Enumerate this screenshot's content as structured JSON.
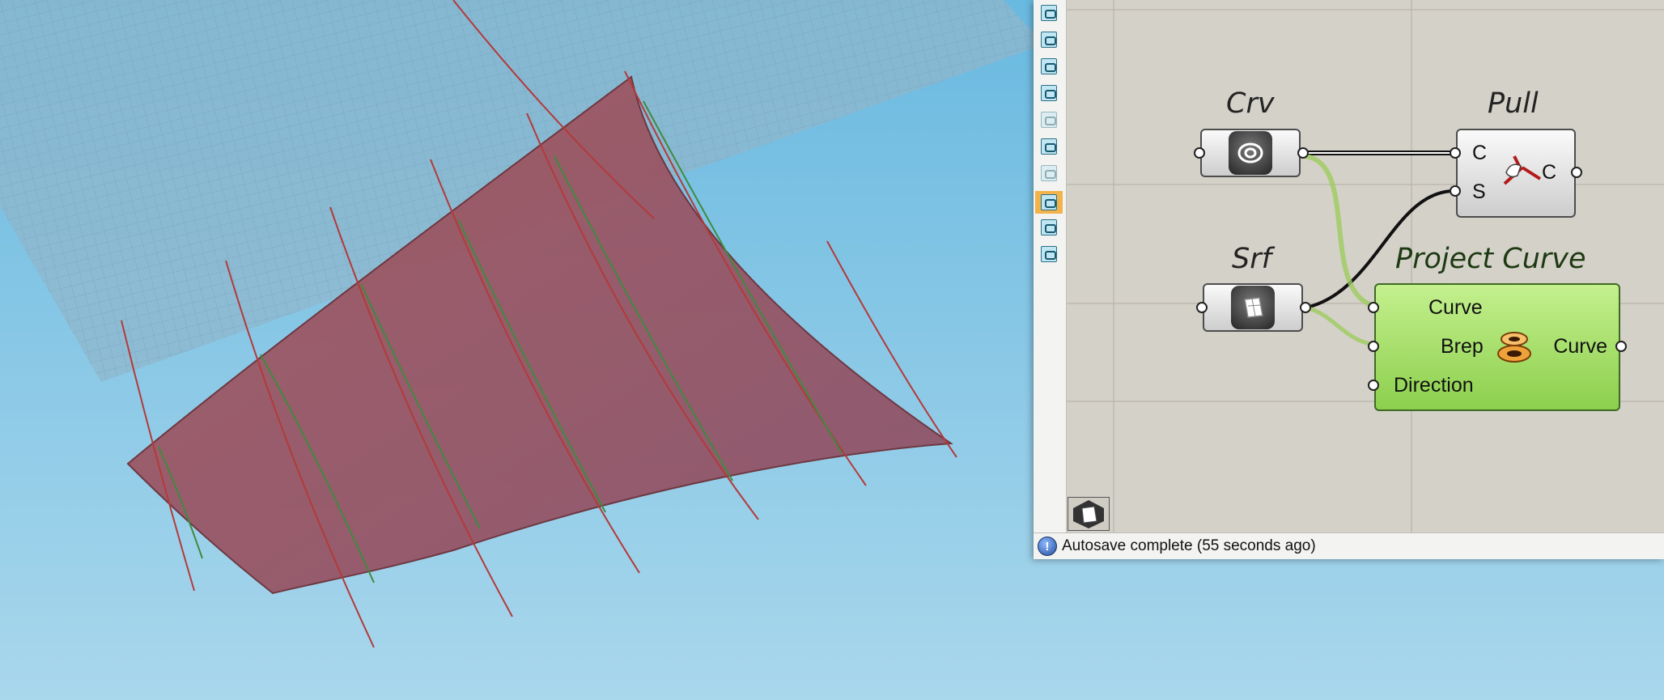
{
  "viewport": {
    "sky_colors": [
      "#69b9e0",
      "#a9d7ec"
    ],
    "plane_grid_color": "#6f9cb2",
    "surface_color": "#9a4a55",
    "curve_color": "#b33a3a",
    "projected_curve_color": "#3f8a3f"
  },
  "toolbar": {
    "icons": [
      "sketch-icon",
      "data-io-icon",
      "wire-display-icon",
      "canvas-select-icon",
      "draw-icon",
      "cluster-icon",
      "group-icon",
      "preview-icon",
      "preview-mesh-icon",
      "solution-icon"
    ],
    "active_icon": "preview-icon"
  },
  "components": {
    "crv": {
      "nickname": "Crv",
      "icon": "curve-param-icon"
    },
    "pull": {
      "nickname": "Pull",
      "input_c": "C",
      "input_s": "S",
      "output_c": "C",
      "icon": "pull-icon"
    },
    "srf": {
      "nickname": "Srf",
      "icon": "surface-param-icon"
    },
    "project": {
      "nickname": "Project Curve",
      "input_curve": "Curve",
      "input_brep": "Brep",
      "input_direction": "Direction",
      "output_curve": "Curve",
      "icon": "project-icon"
    }
  },
  "status": {
    "icon": "info-icon",
    "text": "Autosave complete (55 seconds ago)"
  }
}
